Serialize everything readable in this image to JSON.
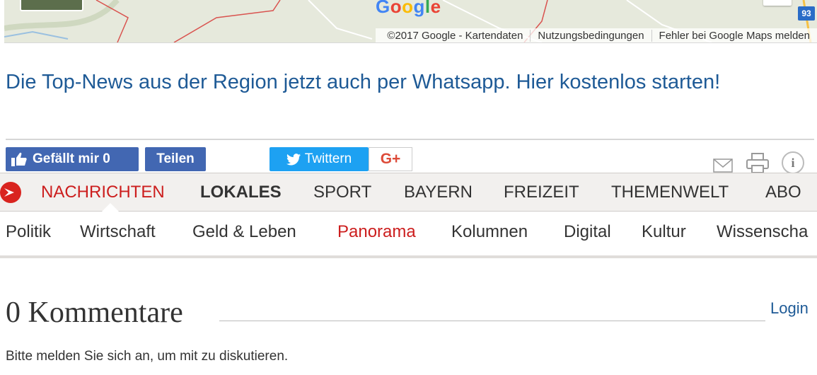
{
  "map": {
    "logo_letters": [
      "G",
      "o",
      "o",
      "g",
      "l",
      "e"
    ],
    "road_badge": "93",
    "footer": [
      "©2017 Google - Kartendaten",
      "Nutzungsbedingungen",
      "Fehler bei Google Maps melden"
    ]
  },
  "promo": {
    "whatsapp_link": "Die Top-News aus der Region jetzt auch per Whatsapp. Hier kostenlos starten!"
  },
  "share": {
    "facebook_like": "Gefällt mir 0",
    "facebook_share": "Teilen",
    "twitter": "Twittern",
    "google_plus": "G+",
    "info_glyph": "i"
  },
  "nav": {
    "items": [
      {
        "label": "NACHRICHTEN",
        "state": "active"
      },
      {
        "label": "LOKALES",
        "state": "bold"
      },
      {
        "label": "SPORT",
        "state": ""
      },
      {
        "label": "BAYERN",
        "state": ""
      },
      {
        "label": "FREIZEIT",
        "state": ""
      },
      {
        "label": "THEMENWELT",
        "state": ""
      },
      {
        "label": "ABO",
        "state": ""
      }
    ]
  },
  "subnav": {
    "items": [
      {
        "label": "Politik"
      },
      {
        "label": "Wirtschaft"
      },
      {
        "label": "Geld & Leben"
      },
      {
        "label": "Panorama",
        "active": true
      },
      {
        "label": "Kolumnen"
      },
      {
        "label": "Digital"
      },
      {
        "label": "Kultur"
      },
      {
        "label": "Wissenscha"
      }
    ]
  },
  "comments": {
    "title": "0 Kommentare",
    "login": "Login",
    "notice": "Bitte melden Sie sich an, um mit zu diskutieren."
  },
  "colors": {
    "link_blue": "#1e5a96",
    "nav_active_red": "#cc1e1e",
    "facebook_blue": "#4267b2",
    "twitter_blue": "#1da1f2",
    "google_plus_red": "#dd4b39"
  }
}
